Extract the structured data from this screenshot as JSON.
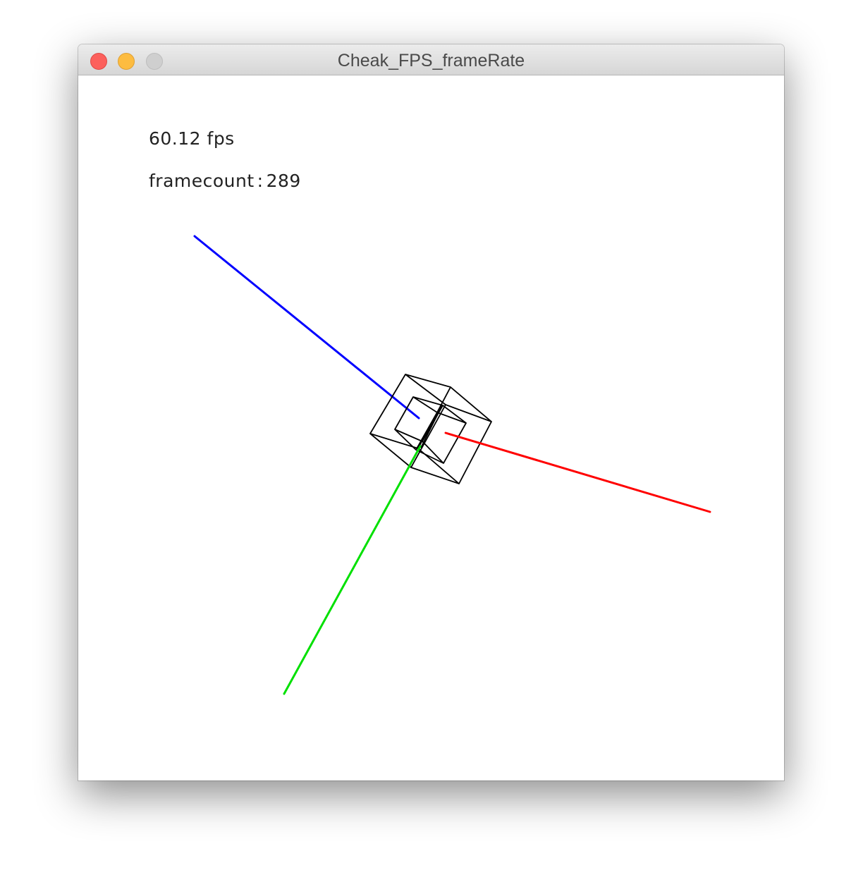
{
  "window": {
    "title": "Cheak_FPS_frameRate"
  },
  "hud": {
    "fps_text": "60.12 fps",
    "framecount_label": "framecount",
    "framecount_value": "289"
  },
  "colors": {
    "x_axis": "#ff0000",
    "y_axis": "#00e000",
    "z_axis": "#0000ff",
    "cube": "#000000"
  }
}
